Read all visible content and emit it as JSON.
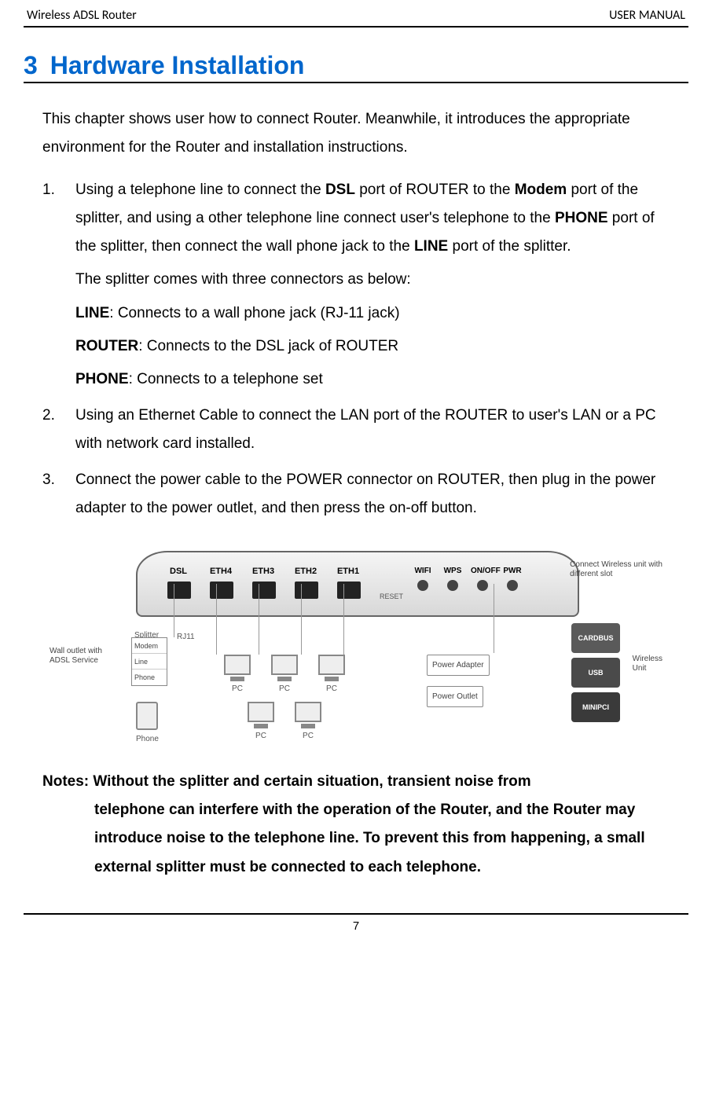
{
  "header": {
    "left": "Wireless ADSL Router",
    "right": "USER MANUAL"
  },
  "chapter": {
    "number": "3",
    "title": "Hardware Installation"
  },
  "intro": "This chapter shows user how to connect Router. Meanwhile, it introduces the appropriate environment for the Router and installation instructions.",
  "steps": [
    {
      "marker": "1.",
      "text_pre": "Using a telephone line to connect the ",
      "b1": "DSL",
      "text_mid1": " port of ROUTER to the ",
      "b2": "Modem",
      "text_mid2": " port of the splitter, and using a other telephone line connect user's telephone to the ",
      "b3": "PHONE",
      "text_mid3": " port of the splitter, then connect the wall phone jack to the ",
      "b4": "LINE",
      "text_end": " port of the splitter.",
      "sub": "The splitter comes with three connectors as below:",
      "connectors": [
        {
          "label": "LINE",
          "desc": ": Connects to a wall phone jack (RJ-11 jack)"
        },
        {
          "label": "ROUTER",
          "desc": ": Connects to the DSL jack of ROUTER"
        },
        {
          "label": "PHONE",
          "desc": ": Connects to a telephone set"
        }
      ]
    },
    {
      "marker": "2.",
      "text": "Using an Ethernet Cable to connect the LAN port of the ROUTER to user's LAN or a PC with network card installed."
    },
    {
      "marker": "3.",
      "text": "Connect the power cable to the POWER connector on ROUTER, then plug in the power adapter to the power outlet, and then press the on-off button."
    }
  ],
  "diagram": {
    "ports": [
      "DSL",
      "ETH4",
      "ETH3",
      "ETH2",
      "ETH1"
    ],
    "controls": [
      "WIFI",
      "WPS",
      "ON/OFF",
      "PWR"
    ],
    "reset": "RESET",
    "rj11": "RJ11",
    "splitter_title": "Splitter",
    "splitter_rows": [
      "Modem",
      "Line",
      "Phone"
    ],
    "wall_callout_l1": "Wall outlet with",
    "wall_callout_l2": "ADSL Service",
    "pc_label": "PC",
    "phone_label": "Phone",
    "power_adapter": "Power Adapter",
    "power_outlet": "Power Outlet",
    "right_callout_l1": "Connect Wireless unit with",
    "right_callout_l2": "different slot",
    "cards": [
      "CARDBUS",
      "USB",
      "MINIPCI"
    ],
    "wireless_l1": "Wireless",
    "wireless_l2": "Unit"
  },
  "notes": {
    "label": "Notes: ",
    "body_first": "Without the splitter and certain situation, transient noise from",
    "body_cont": "telephone can interfere with the operation of the Router, and the Router may introduce noise to the telephone line. To prevent this from happening, a small external splitter must be connected to each telephone."
  },
  "footer": {
    "page": "7"
  }
}
